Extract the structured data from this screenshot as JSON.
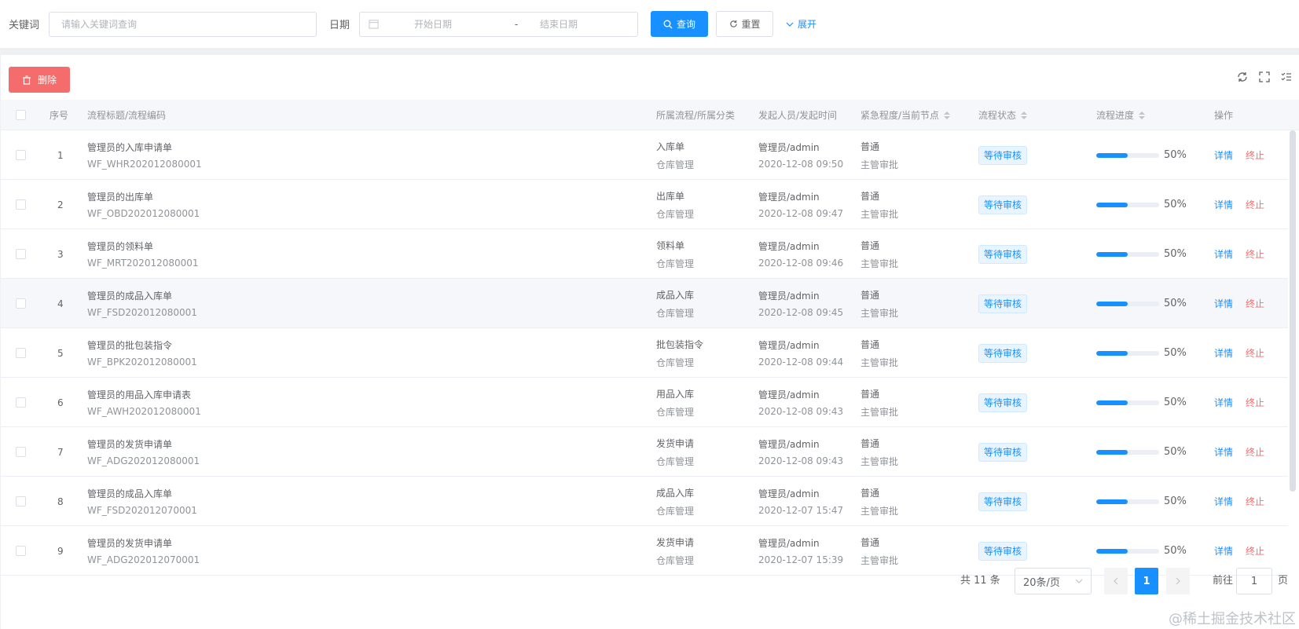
{
  "search": {
    "keyword_label": "关键词",
    "keyword_placeholder": "请输入关键词查询",
    "date_label": "日期",
    "start_placeholder": "开始日期",
    "date_sep": "-",
    "end_placeholder": "结束日期",
    "query_label": "查询",
    "reset_label": "重置",
    "expand_label": "展开"
  },
  "toolbar": {
    "delete_label": "删除"
  },
  "table": {
    "headers": {
      "index": "序号",
      "title": "流程标题/流程编码",
      "category": "所属流程/所属分类",
      "initiator": "发起人员/发起时间",
      "urgency": "紧急程度/当前节点",
      "status": "流程状态",
      "progress": "流程进度",
      "actions": "操作"
    },
    "rows": [
      {
        "no": "1",
        "title": "管理员的入库申请单",
        "code": "WF_WHR202012080001",
        "flow": "入库单",
        "cat": "仓库管理",
        "user": "管理员/admin",
        "time": "2020-12-08 09:50",
        "urgency": "普通",
        "node": "主管审批",
        "status": "等待审核",
        "progress": 0.5,
        "pct": "50%",
        "detail": "详情",
        "stop": "终止"
      },
      {
        "no": "2",
        "title": "管理员的出库单",
        "code": "WF_OBD202012080001",
        "flow": "出库单",
        "cat": "仓库管理",
        "user": "管理员/admin",
        "time": "2020-12-08 09:47",
        "urgency": "普通",
        "node": "主管审批",
        "status": "等待审核",
        "progress": 0.5,
        "pct": "50%",
        "detail": "详情",
        "stop": "终止"
      },
      {
        "no": "3",
        "title": "管理员的领料单",
        "code": "WF_MRT202012080001",
        "flow": "领料单",
        "cat": "仓库管理",
        "user": "管理员/admin",
        "time": "2020-12-08 09:46",
        "urgency": "普通",
        "node": "主管审批",
        "status": "等待审核",
        "progress": 0.5,
        "pct": "50%",
        "detail": "详情",
        "stop": "终止"
      },
      {
        "no": "4",
        "title": "管理员的成品入库单",
        "code": "WF_FSD202012080001",
        "flow": "成品入库",
        "cat": "仓库管理",
        "user": "管理员/admin",
        "time": "2020-12-08 09:45",
        "urgency": "普通",
        "node": "主管审批",
        "status": "等待审核",
        "progress": 0.5,
        "pct": "50%",
        "detail": "详情",
        "stop": "终止"
      },
      {
        "no": "5",
        "title": "管理员的批包装指令",
        "code": "WF_BPK202012080001",
        "flow": "批包装指令",
        "cat": "仓库管理",
        "user": "管理员/admin",
        "time": "2020-12-08 09:44",
        "urgency": "普通",
        "node": "主管审批",
        "status": "等待审核",
        "progress": 0.5,
        "pct": "50%",
        "detail": "详情",
        "stop": "终止"
      },
      {
        "no": "6",
        "title": "管理员的用品入库申请表",
        "code": "WF_AWH202012080001",
        "flow": "用品入库",
        "cat": "仓库管理",
        "user": "管理员/admin",
        "time": "2020-12-08 09:43",
        "urgency": "普通",
        "node": "主管审批",
        "status": "等待审核",
        "progress": 0.5,
        "pct": "50%",
        "detail": "详情",
        "stop": "终止"
      },
      {
        "no": "7",
        "title": "管理员的发货申请单",
        "code": "WF_ADG202012080001",
        "flow": "发货申请",
        "cat": "仓库管理",
        "user": "管理员/admin",
        "time": "2020-12-08 09:43",
        "urgency": "普通",
        "node": "主管审批",
        "status": "等待审核",
        "progress": 0.5,
        "pct": "50%",
        "detail": "详情",
        "stop": "终止"
      },
      {
        "no": "8",
        "title": "管理员的成品入库单",
        "code": "WF_FSD202012070001",
        "flow": "成品入库",
        "cat": "仓库管理",
        "user": "管理员/admin",
        "time": "2020-12-07 15:47",
        "urgency": "普通",
        "node": "主管审批",
        "status": "等待审核",
        "progress": 0.5,
        "pct": "50%",
        "detail": "详情",
        "stop": "终止"
      },
      {
        "no": "9",
        "title": "管理员的发货申请单",
        "code": "WF_ADG202012070001",
        "flow": "发货申请",
        "cat": "仓库管理",
        "user": "管理员/admin",
        "time": "2020-12-07 15:39",
        "urgency": "普通",
        "node": "主管审批",
        "status": "等待审核",
        "progress": 0.5,
        "pct": "50%",
        "detail": "详情",
        "stop": "终止"
      }
    ]
  },
  "pagination": {
    "total": "共 11 条",
    "page_size": "20条/页",
    "current": "1",
    "goto_label": "前往",
    "goto_value": "1",
    "page_suffix": "页"
  },
  "watermark": "@稀土掘金技术社区",
  "colors": {
    "primary": "#1890ff",
    "danger": "#f56c6c"
  }
}
